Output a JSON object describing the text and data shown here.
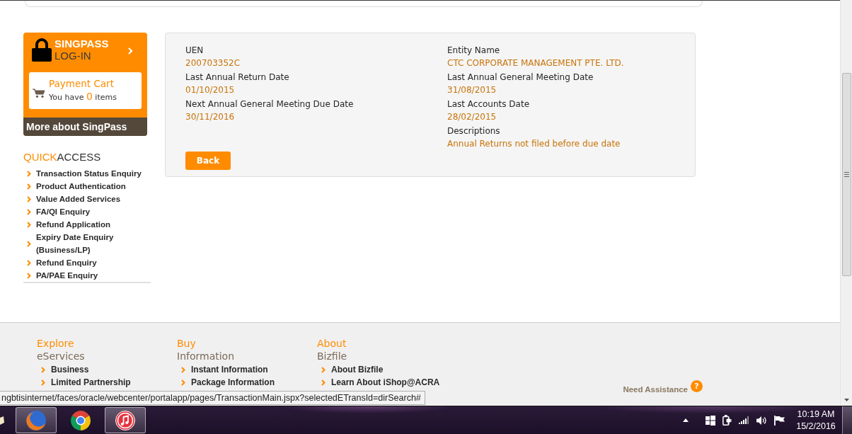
{
  "singpass": {
    "title": "SINGPASS",
    "subtitle": "LOG-IN",
    "more_link": "More about SingPass"
  },
  "payment_cart": {
    "title": "Payment Cart",
    "text_before": "You have",
    "count": "0",
    "text_after": "items"
  },
  "quick_access": {
    "title_accent": "QUICK",
    "title_rest": "ACCESS",
    "items": [
      "Transaction Status Enquiry",
      "Product Authentication",
      "Value Added Services",
      "FA/QI Enquiry",
      "Refund Application",
      "Expiry Date Enquiry (Business/LP)",
      "Refund Enquiry",
      "PA/PAE Enquiry"
    ]
  },
  "details": {
    "columns": [
      {
        "fields": [
          {
            "label": "UEN",
            "value": "200703352C"
          },
          {
            "label": "Last Annual Return Date",
            "value": "01/10/2015"
          },
          {
            "label": "Next Annual General Meeting Due Date",
            "value": "30/11/2016"
          }
        ]
      },
      {
        "fields": [
          {
            "label": "Entity Name",
            "value": "CTC CORPORATE MANAGEMENT PTE. LTD."
          },
          {
            "label": "Last Annual General Meeting Date",
            "value": "31/08/2015"
          },
          {
            "label": "Last Accounts Date",
            "value": "28/02/2015"
          },
          {
            "label": "Descriptions",
            "value": "Annual Returns not filed before due date"
          }
        ]
      }
    ],
    "back_button": "Back"
  },
  "footer": {
    "columns": [
      {
        "heading": "Explore",
        "subheading": "eServices",
        "links": [
          "Business",
          "Limited Partnership"
        ]
      },
      {
        "heading": "Buy",
        "subheading": "Information",
        "links": [
          "Instant Information",
          "Package Information"
        ]
      },
      {
        "heading": "About",
        "subheading": "Bizfile",
        "links": [
          "About Bizfile",
          "Learn About iShop@ACRA"
        ]
      }
    ],
    "assistance": {
      "label": "Need Assistance",
      "help_button": "?"
    }
  },
  "status_url": "ngbtisinternet/faces/oracle/webcenter/portalapp/pages/TransactionMain.jspx?selectedETransId=dirSearch#",
  "taskbar": {
    "apps": [
      {
        "running": true
      },
      {
        "running": false
      },
      {
        "running": true
      }
    ],
    "clock": {
      "time": "10:19 AM",
      "date": "15/2/2016"
    }
  }
}
